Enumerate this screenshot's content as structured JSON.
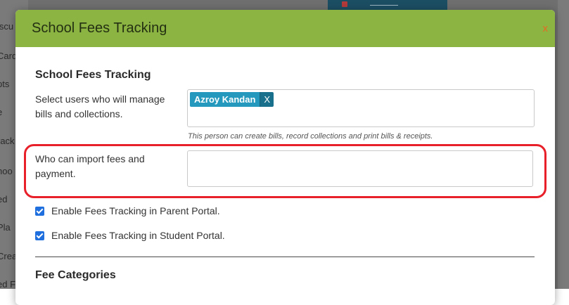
{
  "background": {
    "sidebar_fragments": [
      "iscu",
      "Card",
      "pts",
      "e",
      "rack",
      "hoo",
      "ed",
      "Pla",
      "Crea",
      "ed F"
    ]
  },
  "modal": {
    "title": "School Fees Tracking",
    "close_label": "x",
    "colors": {
      "header": "#8cb443",
      "close": "#e56a24",
      "chip": "#2499bd",
      "chip_remove": "#19708c",
      "highlight": "#e8202a",
      "checkbox": "#1f6fde"
    }
  },
  "fees_section": {
    "title": "School Fees Tracking",
    "managers_label": "Select users who will manage bills and collections.",
    "selected_users": [
      {
        "name": "Azroy Kandan",
        "remove_label": "X"
      }
    ],
    "managers_hint": "This person can create bills, record collections and print bills & receipts.",
    "import_label": "Who can import fees and payment.",
    "import_value": "",
    "parent_portal": {
      "label": "Enable Fees Tracking in Parent Portal.",
      "checked": true
    },
    "student_portal": {
      "label": "Enable Fees Tracking in Student Portal.",
      "checked": true
    }
  },
  "categories_section": {
    "title": "Fee Categories"
  }
}
